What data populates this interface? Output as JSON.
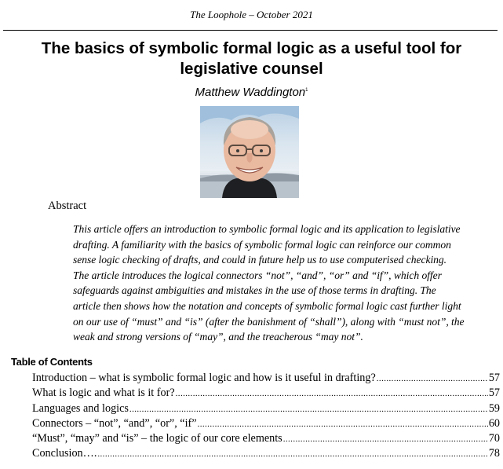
{
  "running_header": "The Loophole – October 2021",
  "title_line1": "The basics of symbolic formal logic as a useful tool for",
  "title_line2": "legislative counsel",
  "author": {
    "name": "Matthew Waddington",
    "footnote_marker": "1"
  },
  "photo": {
    "description": "author-portrait"
  },
  "abstract": {
    "heading": "Abstract",
    "lines": [
      "This article offers an introduction to symbolic formal logic and its application to legislative",
      "drafting. A familiarity with the basics of symbolic formal logic can reinforce our common",
      "sense logic checking of drafts, and could in future help us to use computerised checking.",
      "The article introduces the logical connectors “not”, “and”, “or” and “if”, which offer",
      "safeguards against ambiguities and mistakes in the use of those terms in drafting. The",
      "article then shows how the notation and concepts of symbolic formal logic cast further light",
      "on our use of “must” and “is” (after the banishment of “shall”), along with “must not”, the",
      "weak and strong versions of “may”, and the treacherous “may not”."
    ]
  },
  "toc": {
    "heading": "Table of Contents",
    "entries": [
      {
        "label": "Introduction – what is symbolic formal logic and how is it useful in drafting?",
        "page": "57"
      },
      {
        "label": "What is logic and what is it for?",
        "page": "57"
      },
      {
        "label": "Languages and logics",
        "page": "59"
      },
      {
        "label": "Connectors – “not”, “and”, “or”, “if”",
        "page": "60"
      },
      {
        "label": "“Must”, “may” and “is” – the logic of our core elements",
        "page": "70"
      },
      {
        "label": "Conclusion….",
        "page": "78"
      }
    ]
  }
}
